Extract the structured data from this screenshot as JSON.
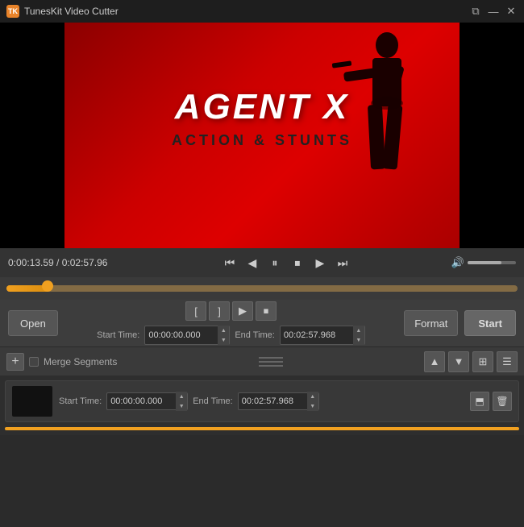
{
  "app": {
    "title": "TunesKit Video Cutter",
    "icon_label": "TK"
  },
  "titlebar": {
    "restore_label": "❐",
    "minimize_label": "—",
    "close_label": "✕"
  },
  "video": {
    "title_main": "AGENT X",
    "title_sub": "ACTION & STUNTS",
    "bg_color": "#cc0000"
  },
  "playback": {
    "current_time": "0:00:13.59",
    "total_time": "0:02:57.96",
    "time_display": "0:00:13.59 / 0:02:57.96"
  },
  "controls": {
    "open_label": "Open",
    "format_label": "Format",
    "start_label": "Start",
    "start_time_label": "Start Time:",
    "end_time_label": "End Time:",
    "start_time_value": "00:00:00.000",
    "end_time_value": "00:02:57.968"
  },
  "segments": {
    "merge_label": "Merge Segments",
    "row": {
      "start_time": "00:00:00.000",
      "end_time": "00:02:57.968"
    }
  },
  "icons": {
    "step_back": "⏮",
    "skip_back": "◀",
    "pause": "⏸",
    "stop": "⏹",
    "play": "▶",
    "skip_fwd": "⏭",
    "volume": "🔊",
    "mark_in": "[",
    "mark_out": "]",
    "preview": "▶",
    "stop_cut": "⏹",
    "up_arrow": "▲",
    "down_arrow": "▼",
    "up_chevron": "▲",
    "down_chevron": "▼",
    "thumbnail_view": "⊞",
    "list_view": "☰",
    "export": "⬒",
    "delete": "🗑"
  }
}
